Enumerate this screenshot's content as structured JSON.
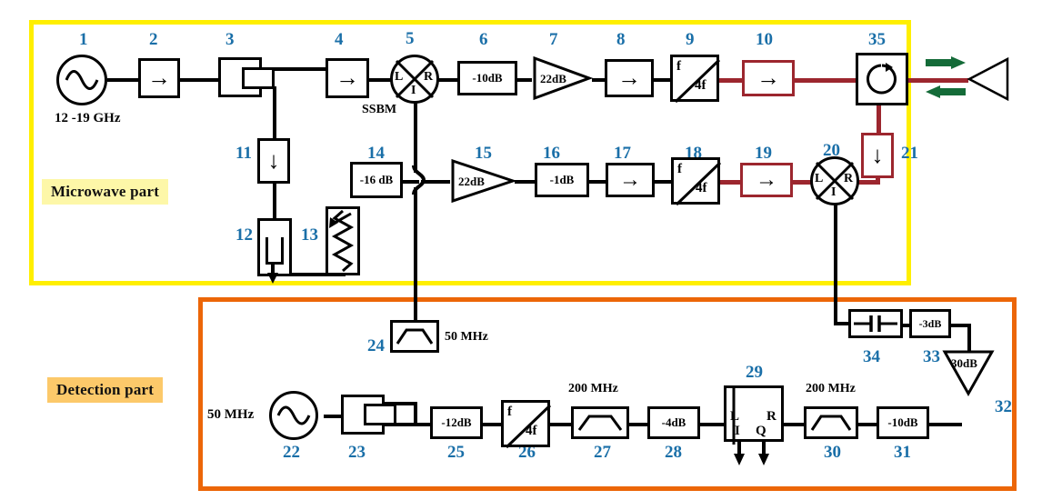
{
  "diagram": {
    "title": "Microwave spectroscopy and detection block diagram",
    "sections": [
      {
        "id": "microwave",
        "label": "Microwave part",
        "frame_color": "#ffef00",
        "label_bg": "#fdf7a8"
      },
      {
        "id": "detection",
        "label": "Detection part",
        "frame_color": "#ec6608",
        "label_bg": "#fcc96a"
      }
    ],
    "annotations": {
      "source_freq": "12  -19 GHz",
      "ssbm": "SSBM",
      "filter24_freq": "50 MHz",
      "source22_freq": "50 MHz",
      "filter27_freq": "200 MHz",
      "filter30_freq": "200 MHz"
    },
    "colors": {
      "number": "#1a6fa8",
      "signal_line": "#000000",
      "high_power_line": "#9c262e",
      "antenna_arrow": "#146b38"
    },
    "components": [
      {
        "n": "1",
        "kind": "source",
        "label": "",
        "sublabel": "12  -19 GHz"
      },
      {
        "n": "2",
        "kind": "isolator",
        "label": "→"
      },
      {
        "n": "3",
        "kind": "coupler",
        "label": ""
      },
      {
        "n": "4",
        "kind": "isolator",
        "label": "→"
      },
      {
        "n": "5",
        "kind": "mixer",
        "label": "SSBM",
        "ports": [
          "L",
          "R",
          "I"
        ]
      },
      {
        "n": "6",
        "kind": "attenuator",
        "label": "-10dB"
      },
      {
        "n": "7",
        "kind": "amplifier",
        "label": "22dB"
      },
      {
        "n": "8",
        "kind": "isolator",
        "label": "→"
      },
      {
        "n": "9",
        "kind": "multiplier",
        "label": "f",
        "sublabel": "4f"
      },
      {
        "n": "10",
        "kind": "isolator",
        "label": "→",
        "line": "high_power"
      },
      {
        "n": "35",
        "kind": "circulator",
        "label": ""
      },
      {
        "n": "11",
        "kind": "isolator-down",
        "label": "↓"
      },
      {
        "n": "12",
        "kind": "terminator",
        "label": ""
      },
      {
        "n": "13",
        "kind": "variable-attenuator",
        "label": ""
      },
      {
        "n": "14",
        "kind": "attenuator",
        "label": "-16 dB"
      },
      {
        "n": "15",
        "kind": "amplifier",
        "label": "22dB"
      },
      {
        "n": "16",
        "kind": "attenuator",
        "label": "-1dB"
      },
      {
        "n": "17",
        "kind": "isolator",
        "label": "→"
      },
      {
        "n": "18",
        "kind": "multiplier",
        "label": "f",
        "sublabel": "4f"
      },
      {
        "n": "19",
        "kind": "isolator",
        "label": "→",
        "line": "high_power"
      },
      {
        "n": "20",
        "kind": "mixer",
        "label": "",
        "ports": [
          "L",
          "R",
          "I"
        ]
      },
      {
        "n": "21",
        "kind": "isolator-down",
        "label": "↓",
        "line": "high_power"
      },
      {
        "n": "22",
        "kind": "source",
        "label": "",
        "sublabel": "50 MHz"
      },
      {
        "n": "23",
        "kind": "coupler",
        "label": ""
      },
      {
        "n": "24",
        "kind": "bandpass",
        "label": "",
        "sublabel": "50 MHz"
      },
      {
        "n": "25",
        "kind": "attenuator",
        "label": "-12dB"
      },
      {
        "n": "26",
        "kind": "multiplier",
        "label": "f",
        "sublabel": "4f"
      },
      {
        "n": "27",
        "kind": "bandpass",
        "label": "",
        "sublabel": "200 MHz"
      },
      {
        "n": "28",
        "kind": "attenuator",
        "label": "-4dB"
      },
      {
        "n": "29",
        "kind": "iq-mixer",
        "label": "",
        "ports": [
          "L",
          "R",
          "I",
          "Q"
        ]
      },
      {
        "n": "30",
        "kind": "bandpass",
        "label": "",
        "sublabel": "200 MHz"
      },
      {
        "n": "31",
        "kind": "attenuator",
        "label": "-10dB"
      },
      {
        "n": "32",
        "kind": "amplifier-down",
        "label": "30dB"
      },
      {
        "n": "33",
        "kind": "attenuator",
        "label": "-3dB"
      },
      {
        "n": "34",
        "kind": "dc-block",
        "label": ""
      }
    ],
    "labels": {
      "n1": "1",
      "n2": "2",
      "n3": "3",
      "n4": "4",
      "n5": "5",
      "n6": "6",
      "n7": "7",
      "n8": "8",
      "n9": "9",
      "n10": "10",
      "n11": "11",
      "n12": "12",
      "n13": "13",
      "n14": "14",
      "n15": "15",
      "n16": "16",
      "n17": "17",
      "n18": "18",
      "n19": "19",
      "n20": "20",
      "n21": "21",
      "n22": "22",
      "n23": "23",
      "n24": "24",
      "n25": "25",
      "n26": "26",
      "n27": "27",
      "n28": "28",
      "n29": "29",
      "n30": "30",
      "n31": "31",
      "n32": "32",
      "n33": "33",
      "n34": "34",
      "n35": "35"
    },
    "values": {
      "v6": "-10dB",
      "v7": "22dB",
      "v9_top": "f",
      "v9_bot": "4f",
      "v14": "-16 dB",
      "v15": "22dB",
      "v16": "-1dB",
      "v18_top": "f",
      "v18_bot": "4f",
      "v25": "-12dB",
      "v26_top": "f",
      "v26_bot": "4f",
      "v28": "-4dB",
      "v31": "-10dB",
      "v32": "30dB",
      "v33": "-3dB",
      "arrow_right": "→",
      "arrow_down": "↓",
      "port_L": "L",
      "port_R": "R",
      "port_I": "I",
      "port_Q": "Q"
    }
  }
}
